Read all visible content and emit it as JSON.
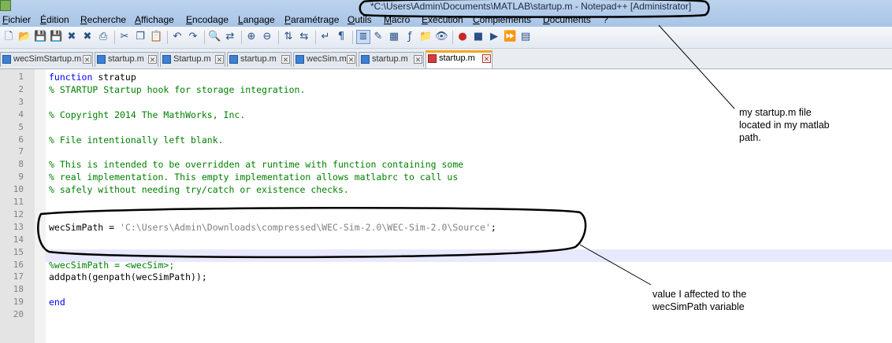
{
  "window": {
    "title": "*C:\\Users\\Admin\\Documents\\MATLAB\\startup.m - Notepad++ [Administrator]"
  },
  "menu": [
    "Fichier",
    "Édition",
    "Recherche",
    "Affichage",
    "Encodage",
    "Langage",
    "Paramétrage",
    "Outils",
    "Macro",
    "Exécution",
    "Compléments",
    "Documents",
    "?"
  ],
  "toolbar": {
    "icons": [
      "new-file-icon",
      "open-file-icon",
      "save-icon",
      "save-all-icon",
      "close-icon",
      "close-all-icon",
      "print-icon",
      "cut-icon",
      "copy-icon",
      "paste-icon",
      "undo-icon",
      "redo-icon",
      "find-icon",
      "replace-icon",
      "zoom-in-icon",
      "zoom-out-icon",
      "sync-vertical-icon",
      "sync-horizontal-icon",
      "word-wrap-icon",
      "show-all-characters-icon",
      "indent-guide-icon",
      "user-defined-language-icon",
      "doc-map-icon",
      "function-list-icon",
      "folder-as-workspace-icon",
      "monitoring-icon",
      "record-macro-icon",
      "stop-record-icon",
      "play-macro-icon",
      "run-macro-multiple-icon",
      "save-macro-icon"
    ]
  },
  "tabs": [
    {
      "label": "wecSimStartup.m",
      "active": false
    },
    {
      "label": "startup.m",
      "active": false
    },
    {
      "label": "Startup.m",
      "active": false
    },
    {
      "label": "startup.m",
      "active": false
    },
    {
      "label": "wecSim.m",
      "active": false
    },
    {
      "label": "startup.m",
      "active": false
    },
    {
      "label": "startup.m",
      "active": true
    }
  ],
  "editor": {
    "lines": [
      {
        "n": "1",
        "kw": "function",
        "text": " stratup",
        "cls": ""
      },
      {
        "n": "2",
        "text": "% STARTUP Startup hook for storage integration.",
        "cls": "cm"
      },
      {
        "n": "3",
        "text": "",
        "cls": ""
      },
      {
        "n": "4",
        "text": "% Copyright 2014 The MathWorks, Inc.",
        "cls": "cm"
      },
      {
        "n": "5",
        "text": "",
        "cls": ""
      },
      {
        "n": "6",
        "text": "% File intentionally left blank.",
        "cls": "cm"
      },
      {
        "n": "7",
        "text": "",
        "cls": ""
      },
      {
        "n": "8",
        "text": "% This is intended to be overridden at runtime with function containing some",
        "cls": "cm"
      },
      {
        "n": "9",
        "text": "% real implementation. This empty implementation allows matlabrc to call us",
        "cls": "cm"
      },
      {
        "n": "10",
        "text": "% safely without needing try/catch or existence checks.",
        "cls": "cm"
      },
      {
        "n": "11",
        "text": "",
        "cls": ""
      },
      {
        "n": "12",
        "text": "",
        "cls": ""
      },
      {
        "n": "13",
        "text": "wecSimPath = ",
        "str": "'C:\\Users\\Admin\\Downloads\\compressed\\WEC-Sim-2.0\\WEC-Sim-2.0\\Source'",
        "tail": ";",
        "cls": ""
      },
      {
        "n": "14",
        "text": "",
        "cls": ""
      },
      {
        "n": "15",
        "text": "",
        "cls": ""
      },
      {
        "n": "16",
        "text": "%wecSimPath = <wecSim>;",
        "cls": "cm"
      },
      {
        "n": "17",
        "text": "addpath(genpath(wecSimPath));",
        "cls": ""
      },
      {
        "n": "18",
        "text": "",
        "cls": ""
      },
      {
        "n": "19",
        "kw": "end",
        "text": "",
        "cls": ""
      },
      {
        "n": "20",
        "text": "",
        "cls": ""
      }
    ]
  },
  "annotations": {
    "note1": "my startup.m file\nlocated in my matlab\npath.",
    "note2": "value I  affected to the\nwecSimPath variable"
  }
}
